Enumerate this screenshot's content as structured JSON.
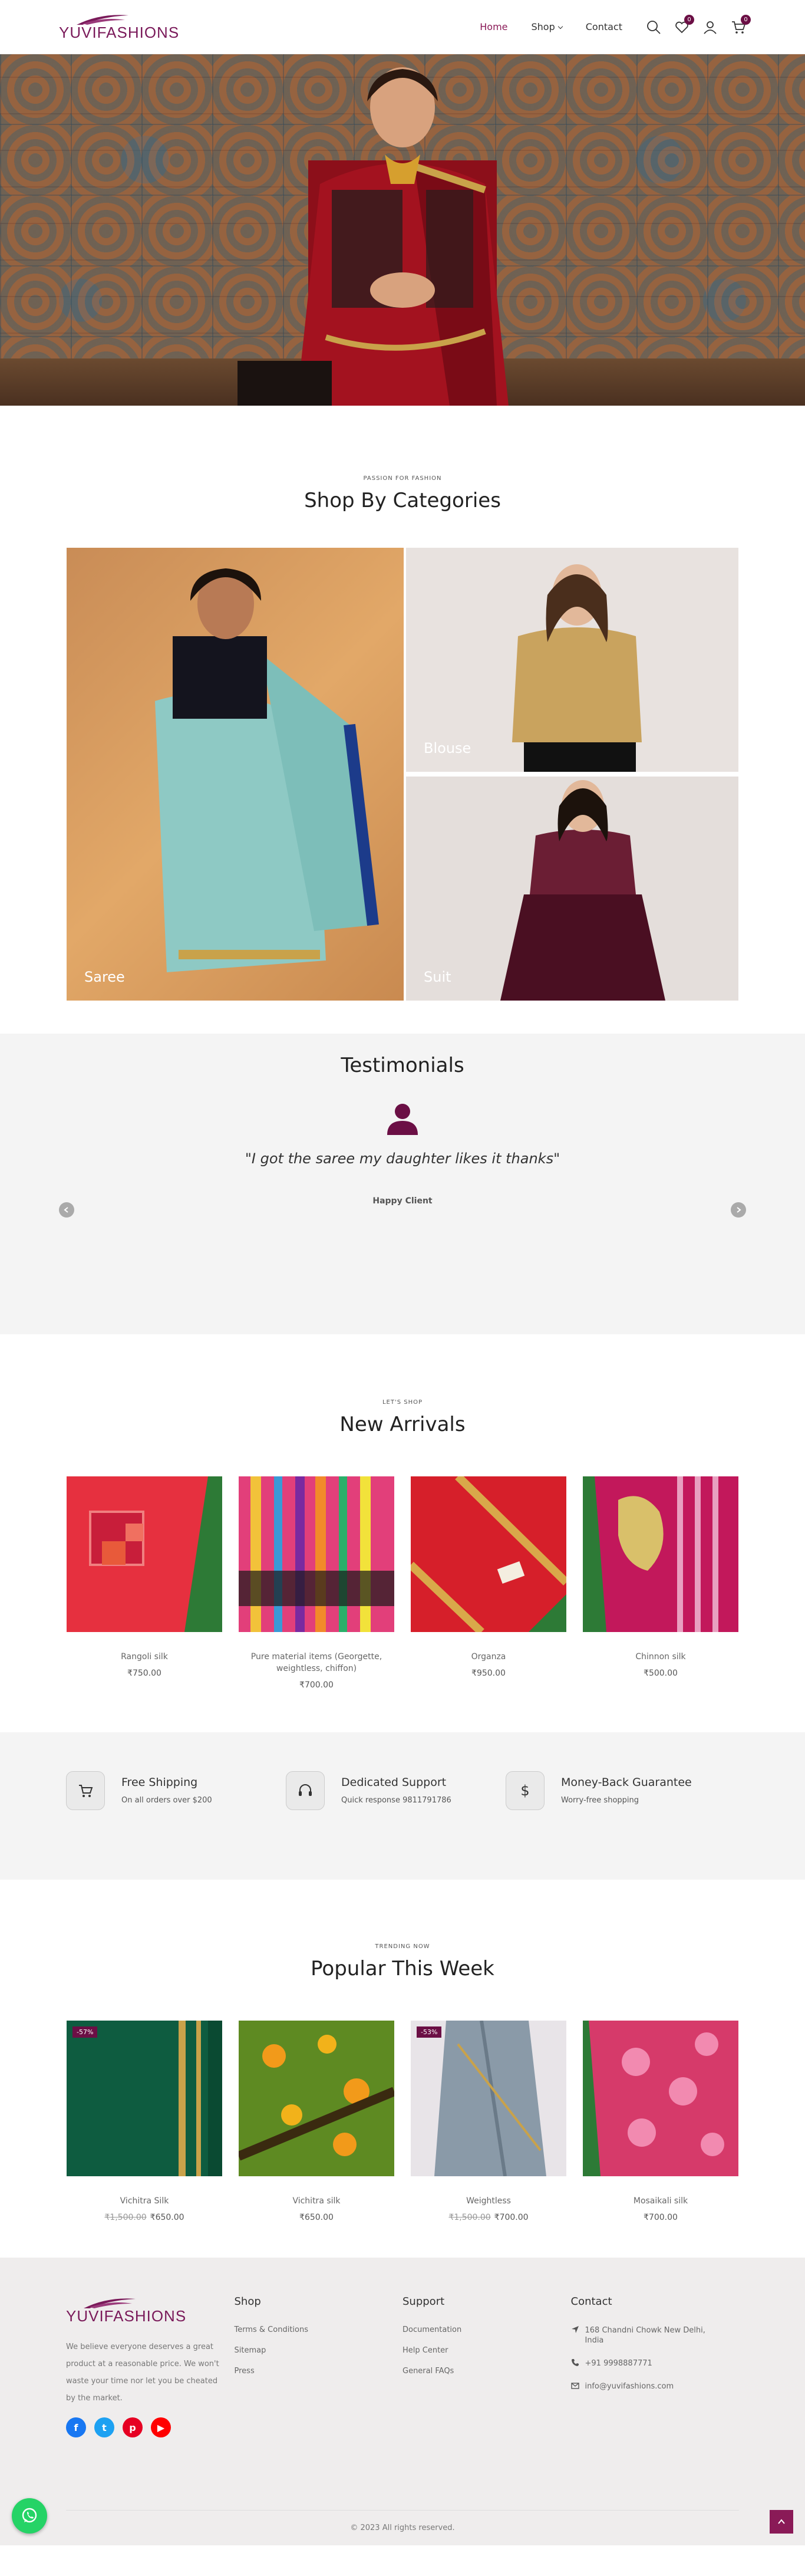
{
  "header": {
    "logo_text": "YUVIFASHIONS",
    "nav": [
      {
        "label": "Home"
      },
      {
        "label": "Shop"
      },
      {
        "label": "Contact"
      }
    ],
    "wishlist_count": "0",
    "cart_count": "0"
  },
  "categories": {
    "eyebrow": "PASSION FOR FASHION",
    "title": "Shop By Categories",
    "items": [
      {
        "label": "Saree"
      },
      {
        "label": "Blouse"
      },
      {
        "label": "Suit"
      }
    ]
  },
  "testimonials": {
    "title": "Testimonials",
    "quote": "\"I got the saree my daughter likes it thanks\"",
    "client": "Happy Client"
  },
  "arrivals": {
    "eyebrow": "LET'S SHOP",
    "title": "New Arrivals",
    "products": [
      {
        "name": "Rangoli silk",
        "price": "₹750.00"
      },
      {
        "name": "Pure material items (Georgette, weightless, chiffon)",
        "price": "₹700.00"
      },
      {
        "name": "Organza",
        "price": "₹950.00"
      },
      {
        "name": "Chinnon silk",
        "price": "₹500.00"
      }
    ]
  },
  "features": [
    {
      "title": "Free Shipping",
      "subtitle": "On all orders over $200",
      "icon": "cart-icon"
    },
    {
      "title": "Dedicated Support",
      "subtitle": "Quick response 9811791786",
      "icon": "headset-icon"
    },
    {
      "title": "Money-Back Guarantee",
      "subtitle": "Worry-free shopping",
      "icon": "dollar-icon"
    }
  ],
  "popular": {
    "eyebrow": "TRENDING NOW",
    "title": "Popular This Week",
    "products": [
      {
        "name": "Vichitra Silk",
        "old_price": "₹1,500.00",
        "price": "₹650.00",
        "badge": "-57%"
      },
      {
        "name": "Vichitra silk",
        "old_price": "",
        "price": "₹650.00",
        "badge": ""
      },
      {
        "name": "Weightless",
        "old_price": "₹1,500.00",
        "price": "₹700.00",
        "badge": "-53%"
      },
      {
        "name": "Mosaikali silk",
        "old_price": "",
        "price": "₹700.00",
        "badge": ""
      }
    ]
  },
  "footer": {
    "logo_text": "YUVIFASHIONS",
    "description": "We believe everyone deserves a great product at a reasonable price. We won't waste your time nor let you be cheated by the market.",
    "shop_title": "Shop",
    "shop_links": [
      "Terms & Conditions",
      "Sitemap",
      "Press"
    ],
    "support_title": "Support",
    "support_links": [
      "Documentation",
      "Help Center",
      "General FAQs"
    ],
    "contact_title": "Contact",
    "address": "168 Chandni Chowk New Delhi, India",
    "phone": "+91 9998887771",
    "email": "info@yuvifashions.com",
    "copyright": "© 2023 All rights reserved."
  },
  "colors": {
    "brand": "#6b0f45",
    "accent": "#8a1a57",
    "whatsapp": "#25d366"
  }
}
